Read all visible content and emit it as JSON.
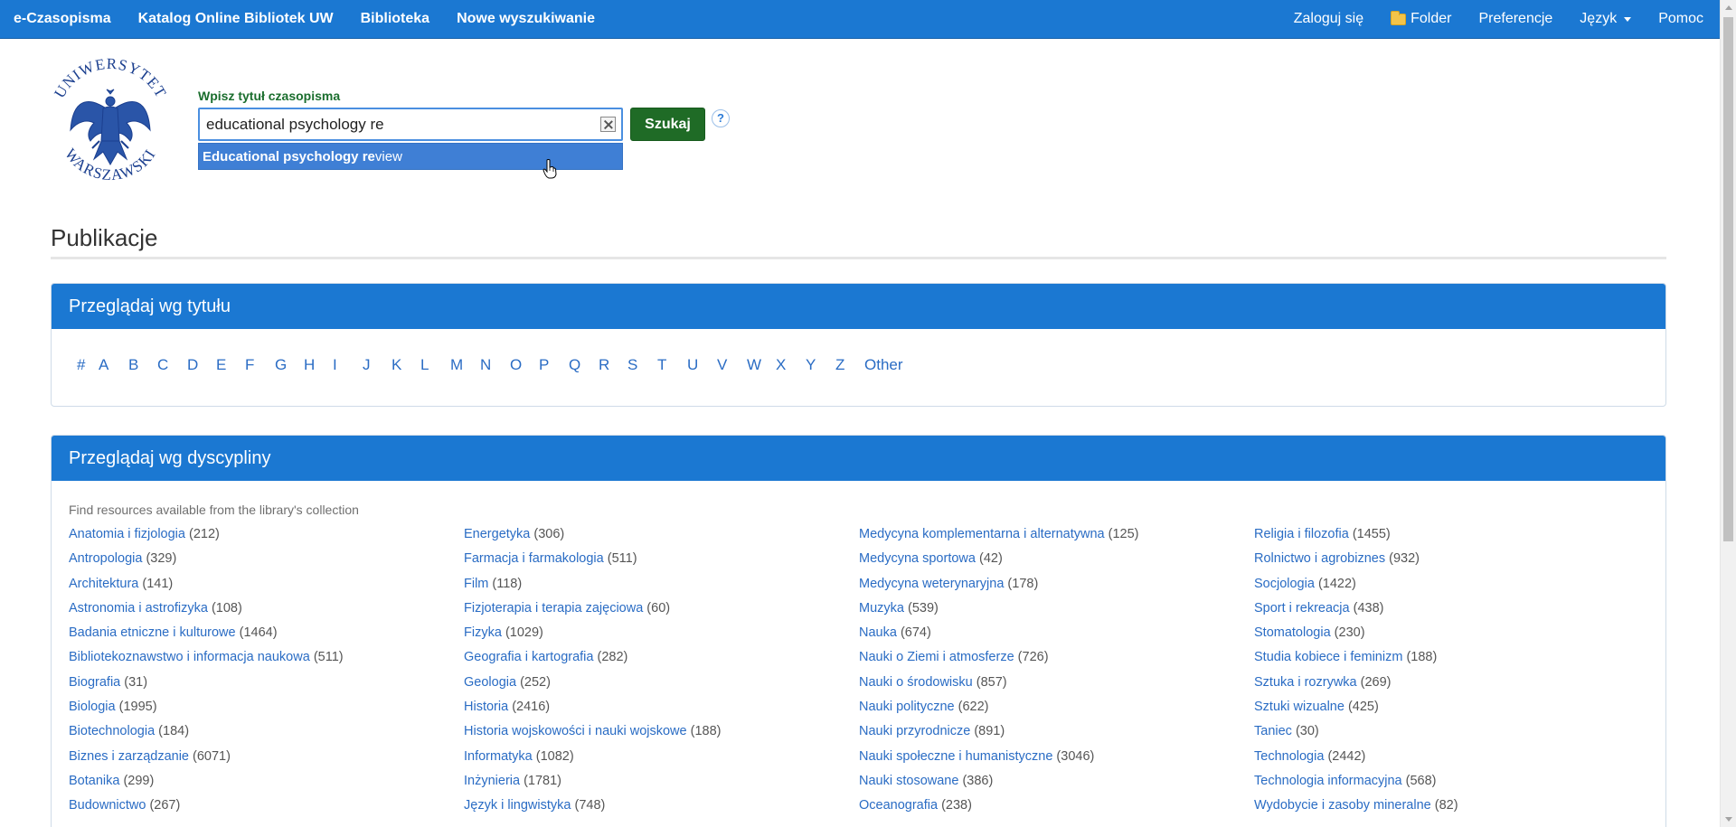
{
  "nav": {
    "left": [
      "e-Czasopisma",
      "Katalog Online Bibliotek UW",
      "Biblioteka",
      "Nowe wyszukiwanie"
    ],
    "login": "Zaloguj się",
    "folder": "Folder",
    "preferences": "Preferencje",
    "language": "Język",
    "help": "Pomoc"
  },
  "logo": {
    "top_text": "UNIWERSYTET",
    "bottom_text": "WARSZAWSKI"
  },
  "search": {
    "label": "Wpisz tytuł czasopisma",
    "value": "educational psychology re",
    "suggestion_bold": "Educational psychology re",
    "suggestion_rest": "view",
    "button": "Szukaj",
    "help": "?"
  },
  "page": {
    "title": "Publikacje"
  },
  "browse_title": {
    "heading": "Przeglądaj wg tytułu",
    "letters": [
      "#",
      "A",
      "B",
      "C",
      "D",
      "E",
      "F",
      "G",
      "H",
      "I",
      "J",
      "K",
      "L",
      "M",
      "N",
      "O",
      "P",
      "Q",
      "R",
      "S",
      "T",
      "U",
      "V",
      "W",
      "X",
      "Y",
      "Z",
      "Other"
    ]
  },
  "browse_discipline": {
    "heading": "Przeglądaj wg dyscypliny",
    "intro": "Find resources available from the library's collection",
    "columns": [
      [
        {
          "name": "Anatomia i fizjologia",
          "count": "(212)"
        },
        {
          "name": "Antropologia",
          "count": "(329)"
        },
        {
          "name": "Architektura",
          "count": "(141)"
        },
        {
          "name": "Astronomia i astrofizyka",
          "count": "(108)"
        },
        {
          "name": "Badania etniczne i kulturowe",
          "count": "(1464)"
        },
        {
          "name": "Bibliotekoznawstwo i informacja naukowa",
          "count": "(511)"
        },
        {
          "name": "Biografia",
          "count": "(31)"
        },
        {
          "name": "Biologia",
          "count": "(1995)"
        },
        {
          "name": "Biotechnologia",
          "count": "(184)"
        },
        {
          "name": "Biznes i zarządzanie",
          "count": "(6071)"
        },
        {
          "name": "Botanika",
          "count": "(299)"
        },
        {
          "name": "Budownictwo",
          "count": "(267)"
        }
      ],
      [
        {
          "name": "Energetyka",
          "count": "(306)"
        },
        {
          "name": "Farmacja i farmakologia",
          "count": "(511)"
        },
        {
          "name": "Film",
          "count": "(118)"
        },
        {
          "name": "Fizjoterapia i terapia zajęciowa",
          "count": "(60)"
        },
        {
          "name": "Fizyka",
          "count": "(1029)"
        },
        {
          "name": "Geografia i kartografia",
          "count": "(282)"
        },
        {
          "name": "Geologia",
          "count": "(252)"
        },
        {
          "name": "Historia",
          "count": "(2416)"
        },
        {
          "name": "Historia wojskowości i nauki wojskowe",
          "count": "(188)"
        },
        {
          "name": "Informatyka",
          "count": "(1082)"
        },
        {
          "name": "Inżynieria",
          "count": "(1781)"
        },
        {
          "name": "Język i lingwistyka",
          "count": "(748)"
        }
      ],
      [
        {
          "name": "Medycyna komplementarna i alternatywna",
          "count": "(125)"
        },
        {
          "name": "Medycyna sportowa",
          "count": "(42)"
        },
        {
          "name": "Medycyna weterynaryjna",
          "count": "(178)"
        },
        {
          "name": "Muzyka",
          "count": "(539)"
        },
        {
          "name": "Nauka",
          "count": "(674)"
        },
        {
          "name": "Nauki o Ziemi i atmosferze",
          "count": "(726)"
        },
        {
          "name": "Nauki o środowisku",
          "count": "(857)"
        },
        {
          "name": "Nauki polityczne",
          "count": "(622)"
        },
        {
          "name": "Nauki przyrodnicze",
          "count": "(891)"
        },
        {
          "name": "Nauki społeczne i humanistyczne",
          "count": "(3046)"
        },
        {
          "name": "Nauki stosowane",
          "count": "(386)"
        },
        {
          "name": "Oceanografia",
          "count": "(238)"
        }
      ],
      [
        {
          "name": "Religia i filozofia",
          "count": "(1455)"
        },
        {
          "name": "Rolnictwo i agrobiznes",
          "count": "(932)"
        },
        {
          "name": "Socjologia",
          "count": "(1422)"
        },
        {
          "name": "Sport i rekreacja",
          "count": "(438)"
        },
        {
          "name": "Stomatologia",
          "count": "(230)"
        },
        {
          "name": "Studia kobiece i feminizm",
          "count": "(188)"
        },
        {
          "name": "Sztuka i rozrywka",
          "count": "(269)"
        },
        {
          "name": "Sztuki wizualne",
          "count": "(425)"
        },
        {
          "name": "Taniec",
          "count": "(30)"
        },
        {
          "name": "Technologia",
          "count": "(2442)"
        },
        {
          "name": "Technologia informacyjna",
          "count": "(568)"
        },
        {
          "name": "Wydobycie i zasoby mineralne",
          "count": "(82)"
        }
      ]
    ]
  },
  "colors": {
    "nav_bg": "#1b78d2",
    "accent_green": "#1f6b26",
    "link": "#2a6cc4"
  }
}
